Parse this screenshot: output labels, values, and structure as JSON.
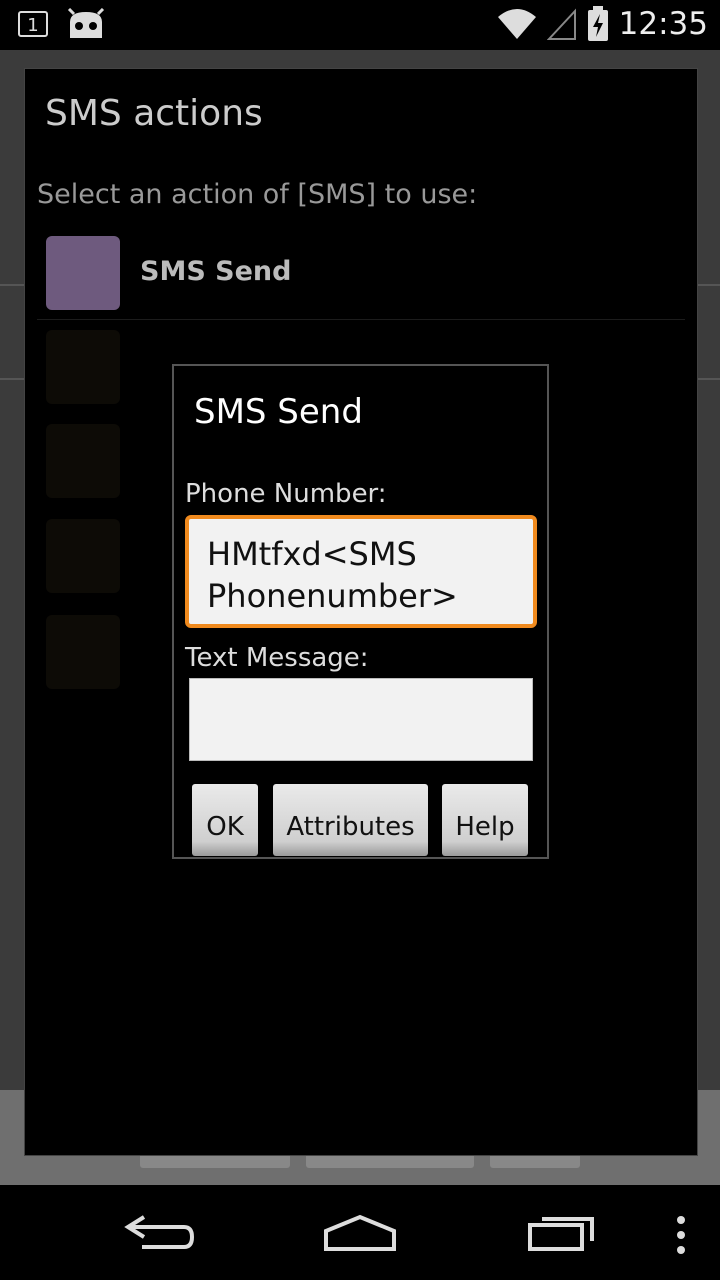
{
  "status_bar": {
    "notification_count": "1",
    "time": "12:35"
  },
  "outer_dialog": {
    "title": "SMS actions",
    "subtitle": "Select an action of [SMS] to use:",
    "actions": [
      {
        "label": "SMS Send",
        "color": "#6e5a7e"
      }
    ]
  },
  "inner_dialog": {
    "title": "SMS Send",
    "phone_label": "Phone Number:",
    "phone_value_line1": "HMtfxd<SMS",
    "phone_value_line2": "Phonenumber>",
    "message_label": "Text Message:",
    "message_value": "",
    "buttons": {
      "ok": "OK",
      "attributes": "Attributes",
      "help": "Help"
    }
  },
  "colors": {
    "focus_border": "#f08a1e",
    "field_bg": "#f2f2f2"
  },
  "icons": {
    "status_left": [
      "notification-box-icon",
      "cyanogenmod-android-icon"
    ],
    "status_right": [
      "wifi-icon",
      "signal-icon",
      "battery-charging-icon"
    ],
    "nav": [
      "back-icon",
      "home-icon",
      "recents-icon",
      "menu-icon"
    ]
  }
}
